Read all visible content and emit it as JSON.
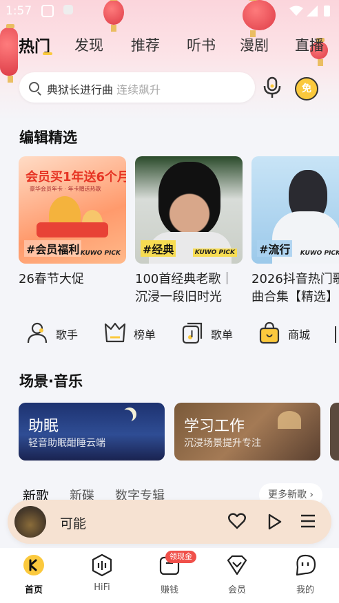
{
  "status_bar": {
    "time": "1:57"
  },
  "top_tabs": [
    {
      "label": "热门",
      "active": true
    },
    {
      "label": "发现"
    },
    {
      "label": "推荐"
    },
    {
      "label": "听书"
    },
    {
      "label": "漫剧"
    },
    {
      "label": "直播"
    }
  ],
  "search": {
    "query": "典狱长进行曲",
    "hint": "连续飙升"
  },
  "free_button": "免",
  "editor_picks": {
    "title": "编辑精选",
    "cards": [
      {
        "cover_text": "会员买1年送6个月",
        "cover_sub": "豪华会员年卡 · 年卡赠送热歌",
        "tag": "#会员福利",
        "brand": "KUWO PICK",
        "title_line1": "26春节大促",
        "title_line2": ""
      },
      {
        "tag": "#经典",
        "brand": "KUWO PICK",
        "title_line1": "100首经典老歌｜",
        "title_line2": "沉浸一段旧时光"
      },
      {
        "tag": "#流行",
        "brand": "KUWO PICK",
        "title_line1": "2026抖音热门歌",
        "title_line2": "曲合集【精选】"
      }
    ]
  },
  "categories": [
    {
      "label": "歌手",
      "icon": "singer-icon"
    },
    {
      "label": "榜单",
      "icon": "chart-icon"
    },
    {
      "label": "歌单",
      "icon": "playlist-icon"
    },
    {
      "label": "商城",
      "icon": "shop-icon"
    }
  ],
  "scenes": {
    "title": "场景·音乐",
    "items": [
      {
        "title": "助眠",
        "subtitle": "轻音助眠酣睡云端"
      },
      {
        "title": "学习工作",
        "subtitle": "沉浸场景提升专注"
      }
    ]
  },
  "new_music": {
    "tabs": [
      {
        "label": "新歌",
        "active": true
      },
      {
        "label": "新碟"
      },
      {
        "label": "数字专辑"
      }
    ],
    "more": "更多新歌 ›"
  },
  "player": {
    "song": "可能"
  },
  "bottom_nav": [
    {
      "label": "首页",
      "icon": "home-icon",
      "active": true
    },
    {
      "label": "HiFi",
      "icon": "hifi-icon"
    },
    {
      "label": "赚钱",
      "icon": "earn-icon",
      "badge": "领现金"
    },
    {
      "label": "会员",
      "icon": "vip-icon"
    },
    {
      "label": "我的",
      "icon": "profile-icon"
    }
  ],
  "colors": {
    "accent_yellow": "#fbc93d",
    "badge_red": "#f0504a",
    "player_bg": "#f6e2d2"
  }
}
